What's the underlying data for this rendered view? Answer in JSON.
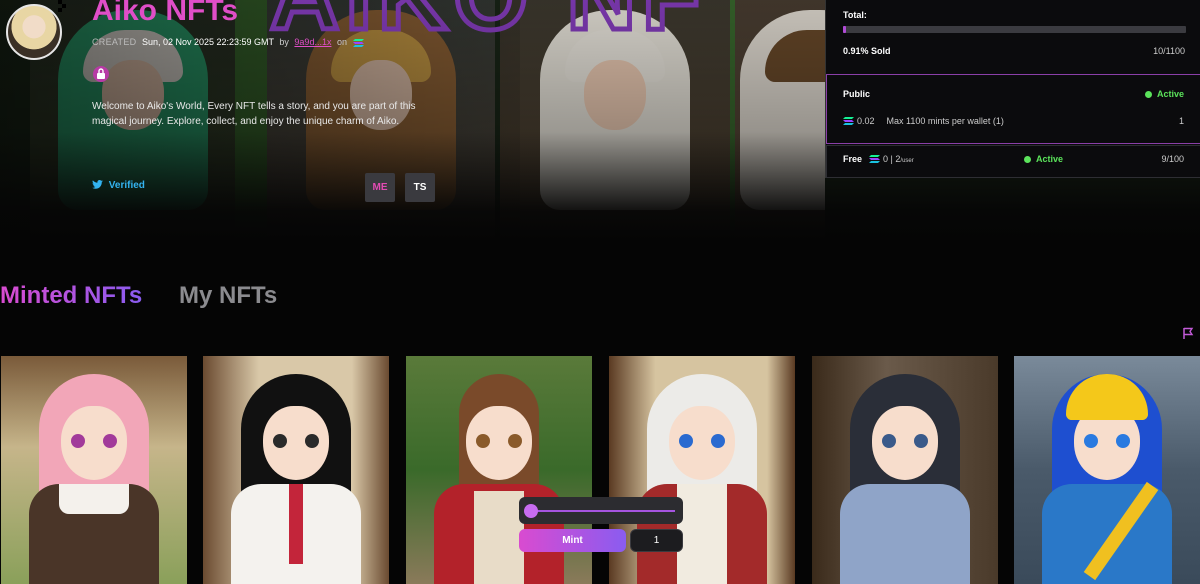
{
  "collection": {
    "title": "Aiko NFTs",
    "created_label": "CREATED",
    "created_date": "Sun, 02 Nov 2025 22:23:59 GMT",
    "by_label": "by",
    "creator_address": "9a9d...1x",
    "on_label": "on",
    "description": "Welcome to Aiko's World, Every NFT tells a story, and you are part of this magical journey. Explore, collect, and enjoy the unique charm of Aiko.",
    "verified_label": "Verified",
    "marketplace_buttons": [
      "ME",
      "TS"
    ]
  },
  "mint_panel": {
    "total_label": "Total:",
    "sold_fraction": 0.0091,
    "sold_text": "0.91% Sold",
    "count_text": "10/1100",
    "public": {
      "name": "Public",
      "status": "Active",
      "price": "0.02",
      "max_text": "Max 1100 mints per wallet (1)",
      "minted_count": "1"
    },
    "free": {
      "name": "Free",
      "price": "0",
      "separator": "|",
      "per_user": "2",
      "per_user_suffix": "/user",
      "status": "Active",
      "count_text": "9/100"
    }
  },
  "tabs": {
    "minted": "Minted NFTs",
    "mine": "My NFTs"
  },
  "mint_widget": {
    "button_label": "Mint",
    "quantity": "1",
    "slider_fraction": 0
  },
  "colors": {
    "accent": "#e04ec8",
    "gradient_start": "#d94bd0",
    "gradient_end": "#8a5cf0",
    "active": "#5be35b",
    "verified": "#33b3f0"
  },
  "nft_cards": [
    {
      "name": "pink-haired-girl-nft"
    },
    {
      "name": "black-haired-schoolgirl-nft"
    },
    {
      "name": "red-hood-girl-nft"
    },
    {
      "name": "white-haired-girl-nft"
    },
    {
      "name": "blue-dress-girl-nft"
    },
    {
      "name": "hard-hat-girl-nft"
    }
  ]
}
